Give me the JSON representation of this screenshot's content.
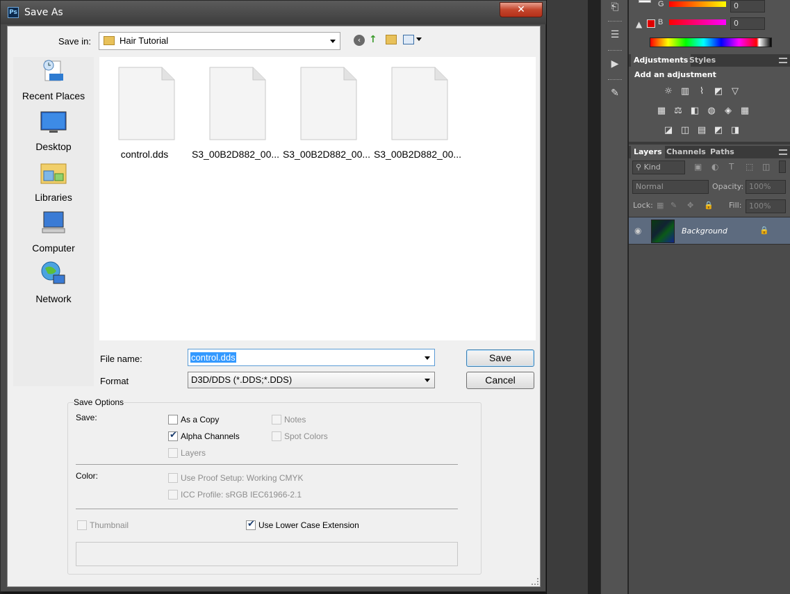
{
  "dialog": {
    "title": "Save As",
    "app_badge": "Ps",
    "close_glyph": "✕",
    "save_in_label": "Save in:",
    "save_in_value": "Hair Tutorial",
    "places": [
      {
        "label": "Recent Places",
        "icon": "recent-places-icon"
      },
      {
        "label": "Desktop",
        "icon": "desktop-icon"
      },
      {
        "label": "Libraries",
        "icon": "libraries-icon"
      },
      {
        "label": "Computer",
        "icon": "computer-icon"
      },
      {
        "label": "Network",
        "icon": "network-icon"
      }
    ],
    "files": [
      "control.dds",
      "S3_00B2D882_00...",
      "S3_00B2D882_00...",
      "S3_00B2D882_00..."
    ],
    "file_name_label": "File name:",
    "file_name_value": "control.dds",
    "format_label": "Format",
    "format_value": "D3D/DDS (*.DDS;*.DDS)",
    "save_button": "Save",
    "cancel_button": "Cancel",
    "save_options": {
      "legend": "Save Options",
      "save_label": "Save:",
      "as_a_copy": {
        "label": "As a Copy",
        "checked": false,
        "enabled": true
      },
      "notes": {
        "label": "Notes",
        "checked": false,
        "enabled": false
      },
      "alpha_channels": {
        "label": "Alpha Channels",
        "checked": true,
        "enabled": true
      },
      "spot_colors": {
        "label": "Spot Colors",
        "checked": false,
        "enabled": false
      },
      "layers": {
        "label": "Layers",
        "checked": false,
        "enabled": false
      },
      "color_label": "Color:",
      "use_proof_setup": {
        "label": "Use Proof Setup:  Working CMYK",
        "checked": false,
        "enabled": false
      },
      "icc_profile": {
        "label": "ICC Profile:  sRGB IEC61966-2.1",
        "checked": false,
        "enabled": false
      },
      "thumbnail": {
        "label": "Thumbnail",
        "checked": false,
        "enabled": false
      },
      "lower_case_ext": {
        "label": "Use Lower Case Extension",
        "checked": true,
        "enabled": true
      }
    }
  },
  "color_panel": {
    "g_label": "G",
    "g_value": "0",
    "b_label": "B",
    "b_value": "0"
  },
  "adjustments_panel": {
    "tabs": [
      "Adjustments",
      "Styles"
    ],
    "heading": "Add an adjustment",
    "icons": [
      "brightness-icon",
      "levels-icon",
      "curves-icon",
      "exposure-icon",
      "vibrance-icon",
      "hue-saturation-icon",
      "color-balance-icon",
      "black-white-icon",
      "photo-filter-icon",
      "channel-mixer-icon",
      "color-lookup-icon",
      "invert-icon",
      "posterize-icon",
      "threshold-icon",
      "gradient-map-icon",
      "selective-color-icon"
    ],
    "glyphs": [
      "☼",
      "▥",
      "⌇",
      "◩",
      "▽",
      "▦",
      "⚖",
      "◧",
      "◍",
      "◈",
      "▦",
      "◪",
      "◫",
      "▤",
      "◩",
      "◨"
    ]
  },
  "layers_panel": {
    "tabs": [
      "Layers",
      "Channels",
      "Paths"
    ],
    "kind_label": "Kind",
    "blend_mode": "Normal",
    "opacity_label": "Opacity:",
    "opacity_value": "100%",
    "lock_label": "Lock:",
    "fill_label": "Fill:",
    "fill_value": "100%",
    "layer_name": "Background"
  },
  "colors": {
    "accent_selection": "#3399ff",
    "dialog_client_bg": "#f0f0f0",
    "ps_panel_bg": "#535353",
    "selected_layer_bg": "#5d6b7f",
    "close_button": "#c4462c"
  }
}
